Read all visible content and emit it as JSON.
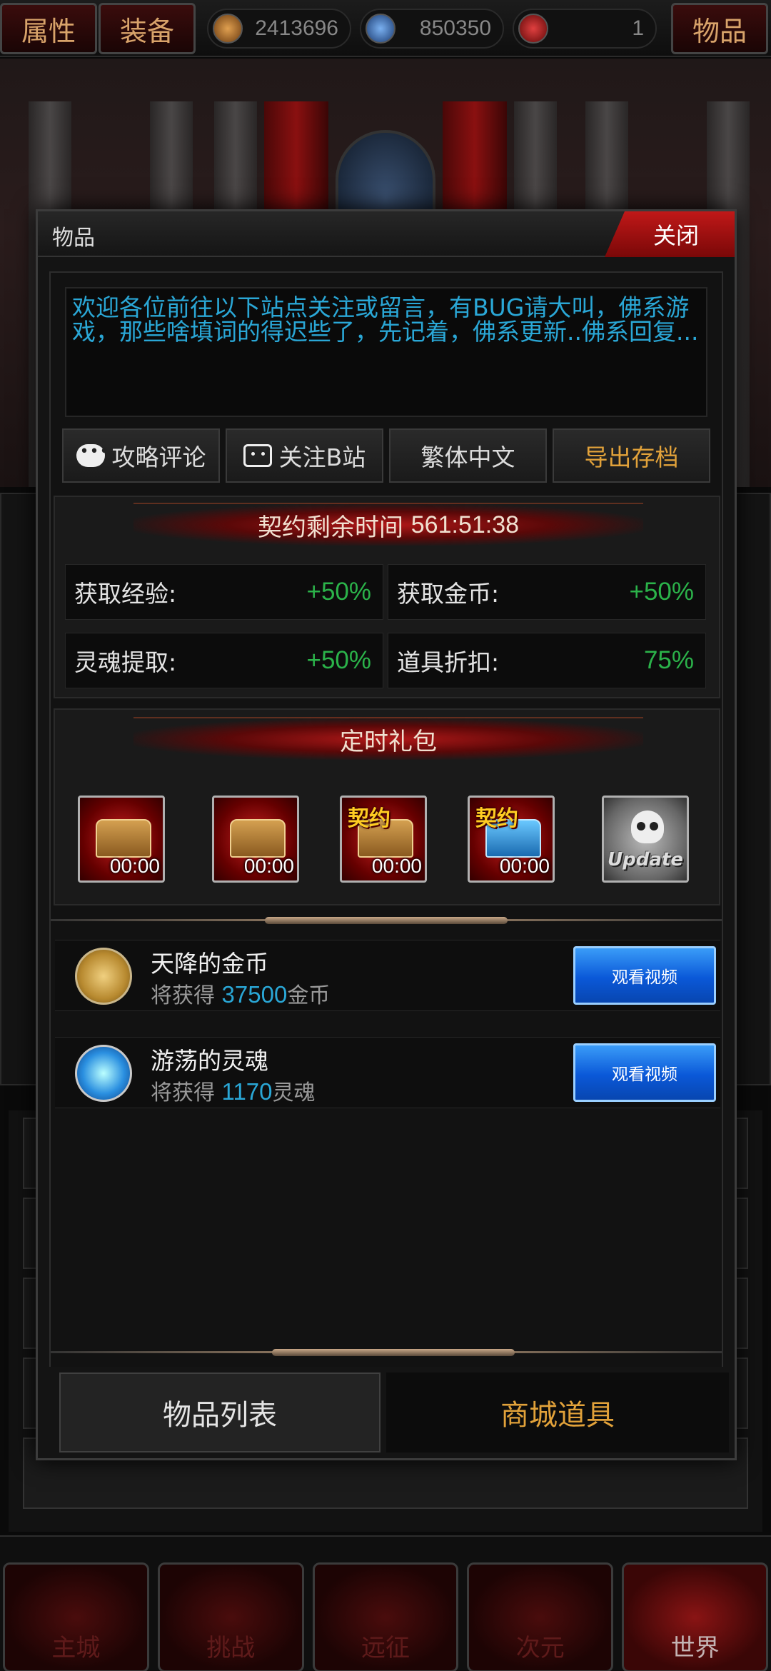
{
  "topbar": {
    "attr_label": "属性",
    "equip_label": "装备",
    "items_label": "物品",
    "resources": [
      {
        "icon": "rune-coin-icon",
        "value": "2413696",
        "color": "#c07a30"
      },
      {
        "icon": "blue-skull-icon",
        "value": "850350",
        "color": "#3a7ac8"
      },
      {
        "icon": "red-emblem-icon",
        "value": "1",
        "color": "#c02020"
      }
    ]
  },
  "nav": {
    "items": [
      {
        "label": "主城",
        "active": false
      },
      {
        "label": "挑战",
        "active": false
      },
      {
        "label": "远征",
        "active": false
      },
      {
        "label": "次元",
        "active": false
      },
      {
        "label": "世界",
        "active": true
      }
    ]
  },
  "modal": {
    "title": "物品",
    "close_label": "关闭",
    "notice": "欢迎各位前往以下站点关注或留言，有BUG请大叫，佛系游戏，那些啥填词的得迟些了，先记着，佛系更新..佛系回复...",
    "buttons": {
      "guide": "攻略评论",
      "bilibili": "关注B站",
      "traditional": "繁体中文",
      "export": "导出存档"
    },
    "contract": {
      "title_prefix": "契约剩余时间",
      "time": "561:51:38",
      "stats": [
        {
          "label": "获取经验:",
          "value": "+50%"
        },
        {
          "label": "获取金币:",
          "value": "+50%"
        },
        {
          "label": "灵魂提取:",
          "value": "+50%"
        },
        {
          "label": "道具折扣:",
          "value": "75%"
        }
      ]
    },
    "gifts": {
      "title": "定时礼包",
      "items": [
        {
          "tag": "",
          "time": "00:00",
          "gem": "#3aa0ff"
        },
        {
          "tag": "",
          "time": "00:00",
          "gem": "#30c040"
        },
        {
          "tag": "契约",
          "time": "00:00",
          "gem": "#e0b030"
        },
        {
          "tag": "契约",
          "time": "00:00",
          "gem": "#40b0ff"
        },
        {
          "tag": "Update",
          "time": "",
          "gem": "#cccccc"
        }
      ]
    },
    "rewards": [
      {
        "title": "天降的金币",
        "prefix": "将获得",
        "amount": "37500",
        "unit": "金币",
        "button": "观看视频"
      },
      {
        "title": "游荡的灵魂",
        "prefix": "将获得",
        "amount": "1170",
        "unit": "灵魂",
        "button": "观看视频"
      }
    ],
    "tabs": {
      "item_list": "物品列表",
      "shop_items": "商城道具"
    }
  }
}
